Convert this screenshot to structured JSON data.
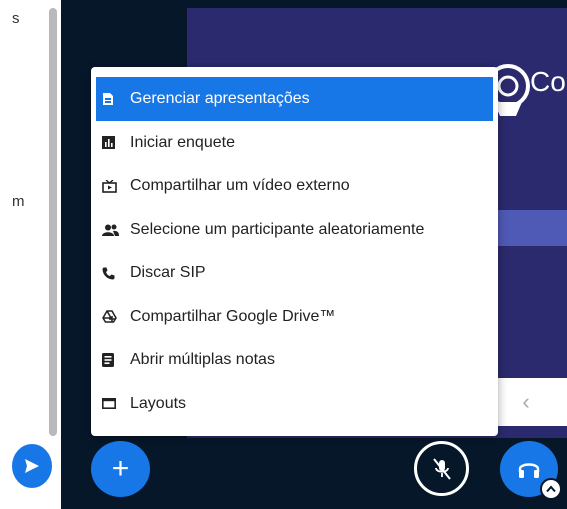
{
  "chat": {
    "fragment_top": "s",
    "fragment_mid": "m"
  },
  "presentation": {
    "logo_text": "Co",
    "prev_glyph": "‹"
  },
  "actions_menu": {
    "items": [
      {
        "label": "Gerenciar apresentações",
        "icon": "file-icon",
        "active": true
      },
      {
        "label": "Iniciar enquete",
        "icon": "poll-icon",
        "active": false
      },
      {
        "label": "Compartilhar um vídeo externo",
        "icon": "video-icon",
        "active": false
      },
      {
        "label": "Selecione um participante aleatoriamente",
        "icon": "users-icon",
        "active": false
      },
      {
        "label": "Discar SIP",
        "icon": "phone-icon",
        "active": false
      },
      {
        "label": "Compartilhar Google Drive™",
        "icon": "drive-icon",
        "active": false
      },
      {
        "label": "Abrir múltiplas notas",
        "icon": "notes-icon",
        "active": false
      },
      {
        "label": "Layouts",
        "icon": "layout-icon",
        "active": false
      }
    ]
  },
  "toolbar": {
    "plus_glyph": "+"
  },
  "colors": {
    "accent": "#1877e6",
    "dark_bg": "#06172a",
    "presentation_bg": "#2b2a6e",
    "band": "#4f59b6"
  }
}
